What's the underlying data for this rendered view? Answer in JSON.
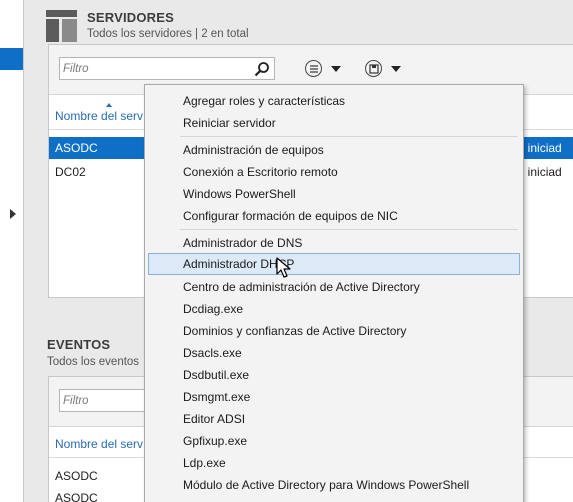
{
  "servers": {
    "title": "SERVIDORES",
    "subtitle": "Todos los servidores | 2 en total",
    "filter_placeholder": "Filtro",
    "column_name": "Nombre del serv",
    "rows": [
      {
        "name": "ASODC",
        "status": "no iniciad",
        "selected": true
      },
      {
        "name": "DC02",
        "status": "no iniciad",
        "selected": false
      }
    ]
  },
  "events": {
    "title": "EVENTOS",
    "subtitle": "Todos los eventos",
    "filter_placeholder": "Filtro",
    "column_name": "Nombre del serv",
    "rows": [
      {
        "name": "ASODC"
      },
      {
        "name": "ASODC"
      }
    ]
  },
  "context_menu": {
    "groups": [
      [
        "Agregar roles y características",
        "Reiniciar servidor"
      ],
      [
        "Administración de equipos",
        "Conexión a Escritorio remoto",
        "Windows PowerShell",
        "Configurar formación de equipos de NIC"
      ],
      [
        "Administrador de DNS",
        "Administrador DHCP",
        "Centro de administración de Active Directory",
        "Dcdiag.exe",
        "Dominios y confianzas de Active Directory",
        "Dsacls.exe",
        "Dsdbutil.exe",
        "Dsmgmt.exe",
        "Editor ADSI",
        "Gpfixup.exe",
        "Ldp.exe",
        "Módulo de Active Directory para Windows PowerShell"
      ]
    ],
    "highlighted": "Administrador DHCP"
  },
  "colors": {
    "selection": "#0f6fc6",
    "link": "#2a69b8",
    "menu_highlight": "#dce9f6"
  },
  "icons": [
    "server-group-icon",
    "search-icon",
    "list-options-icon",
    "save-icon",
    "chevron-down-icon",
    "mouse-cursor-icon"
  ]
}
